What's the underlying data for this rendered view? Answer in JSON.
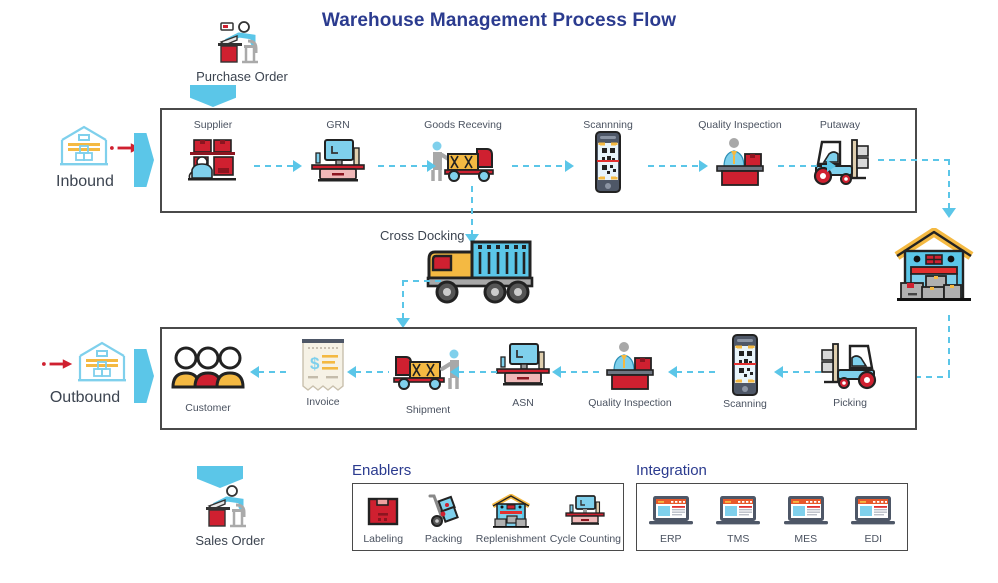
{
  "title": "Warehouse Management Process Flow",
  "colors": {
    "title": "#2b3b8f",
    "accent_cyan": "#5bc6e8",
    "accent_red": "#cf2030",
    "box_border": "#4a4a4a",
    "label": "#4a5260"
  },
  "entry_points": {
    "purchase_order": {
      "label": "Purchase Order",
      "icon": "person-at-desk-icon"
    },
    "sales_order": {
      "label": "Sales Order",
      "icon": "person-at-desk-icon"
    }
  },
  "lanes": {
    "inbound": {
      "name": "Inbound",
      "icon": "warehouse-outline-icon",
      "steps": [
        {
          "label": "Supplier",
          "icon": "supplier-shelves-icon"
        },
        {
          "label": "GRN",
          "icon": "desktop-computer-icon"
        },
        {
          "label": "Goods Receving",
          "icon": "truck-unloading-icon"
        },
        {
          "label": "Scannning",
          "icon": "mobile-qr-scan-icon"
        },
        {
          "label": "Quality Inspection",
          "icon": "inspector-desk-icon"
        },
        {
          "label": "Putaway",
          "icon": "forklift-icon"
        }
      ]
    },
    "outbound": {
      "name": "Outbound",
      "icon": "warehouse-outline-icon",
      "steps": [
        {
          "label": "Customer",
          "icon": "customers-group-icon"
        },
        {
          "label": "Invoice",
          "icon": "invoice-receipt-icon"
        },
        {
          "label": "Shipment",
          "icon": "truck-loading-icon"
        },
        {
          "label": "ASN",
          "icon": "desktop-computer-icon"
        },
        {
          "label": "Quality Inspection",
          "icon": "inspector-desk-icon"
        },
        {
          "label": "Scanning",
          "icon": "mobile-qr-scan-icon"
        },
        {
          "label": "Picking",
          "icon": "forklift-icon"
        }
      ]
    }
  },
  "cross_docking": {
    "label": "Cross Docking",
    "icon": "container-truck-icon"
  },
  "warehouse_hub": {
    "icon": "warehouse-building-icon"
  },
  "enablers": {
    "title": "Enablers",
    "items": [
      {
        "label": "Labeling",
        "icon": "labeled-box-icon"
      },
      {
        "label": "Packing",
        "icon": "hand-trolley-icon"
      },
      {
        "label": "Replenishment",
        "icon": "warehouse-building-icon"
      },
      {
        "label": "Cycle Counting",
        "icon": "desktop-computer-icon"
      }
    ]
  },
  "integration": {
    "title": "Integration",
    "items": [
      {
        "label": "ERP",
        "icon": "laptop-screen-icon"
      },
      {
        "label": "TMS",
        "icon": "laptop-screen-icon"
      },
      {
        "label": "MES",
        "icon": "laptop-screen-icon"
      },
      {
        "label": "EDI",
        "icon": "laptop-screen-icon"
      }
    ]
  }
}
